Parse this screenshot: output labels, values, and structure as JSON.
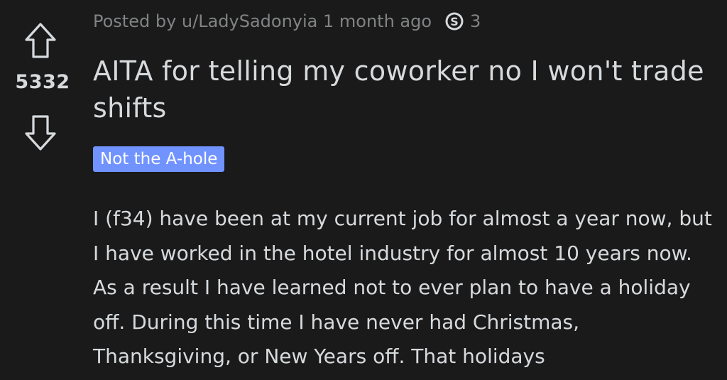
{
  "vote": {
    "score": "5332",
    "upvote_icon": "upvote-arrow-icon",
    "downvote_icon": "downvote-arrow-icon"
  },
  "post": {
    "meta": "Posted by u/LadySadonyia 1 month ago",
    "award_icon": "silver-award-icon",
    "award_count": "3",
    "title": "AITA for telling my coworker no I won't trade shifts",
    "flair": "Not the A-hole",
    "body": "I (f34) have been at my current job for almost a year now, but I have worked in the hotel industry for almost 10 years now. As a result I have learned not to ever plan to have a holiday off. During this time I have never had Christmas, Thanksgiving, or New Years off. That holidays"
  },
  "colors": {
    "background": "#1a1a1b",
    "text": "#d7dadc",
    "meta_text": "#818384",
    "flair_bg": "#7193ff"
  }
}
